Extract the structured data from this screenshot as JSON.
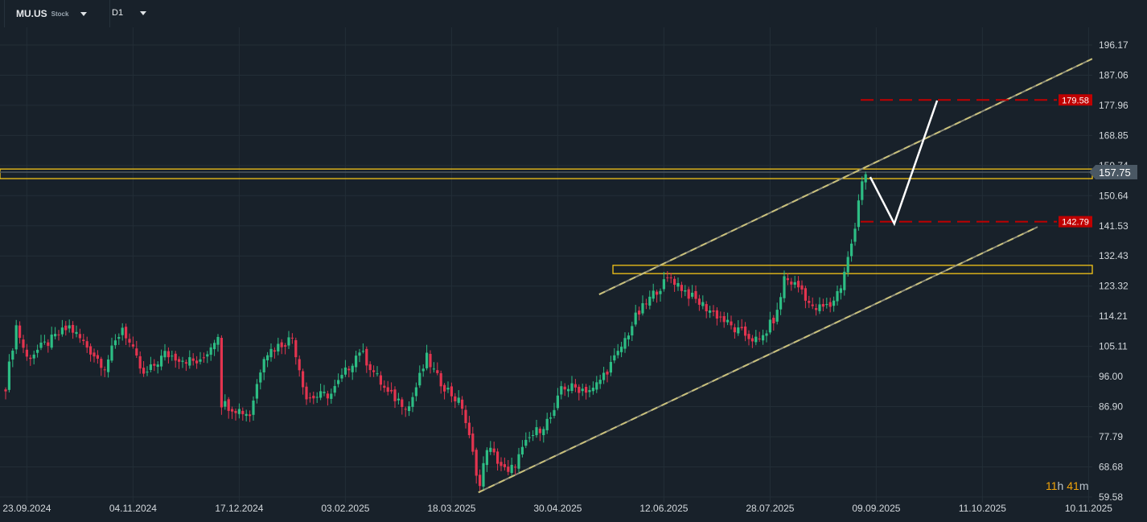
{
  "header": {
    "symbol": "MU.US",
    "type": "Stock",
    "timeframe": "D1"
  },
  "countdown": {
    "hours": "11",
    "h": "h",
    "minutes": "41",
    "m": "m"
  },
  "colors": {
    "bg": "#18212a",
    "grid": "#232e37",
    "up": "#2dbd84",
    "down": "#e3344f",
    "zone": "#f5c518",
    "channel": "#c9c07a",
    "target": "#c00000",
    "path": "#ffffff",
    "current": "#4a5560",
    "axisText": "#d3d8dc"
  },
  "chart_data": {
    "type": "candlestick",
    "title": "MU.US D1",
    "ylim": [
      59.58,
      196.17
    ],
    "y_ticks": [
      "196.17",
      "187.06",
      "177.96",
      "168.85",
      "159.74",
      "150.64",
      "141.53",
      "132.43",
      "123.32",
      "114.21",
      "105.11",
      "96.00",
      "86.90",
      "77.79",
      "68.68",
      "59.58"
    ],
    "x_ticks": [
      {
        "bar": 6,
        "label": "23.09.2024"
      },
      {
        "bar": 36,
        "label": "04.11.2024"
      },
      {
        "bar": 66,
        "label": "17.12.2024"
      },
      {
        "bar": 96,
        "label": "03.02.2025"
      },
      {
        "bar": 126,
        "label": "18.03.2025"
      },
      {
        "bar": 156,
        "label": "30.04.2025"
      },
      {
        "bar": 186,
        "label": "12.06.2025"
      },
      {
        "bar": 216,
        "label": "28.07.2025"
      },
      {
        "bar": 246,
        "label": "09.09.2025"
      },
      {
        "bar": 276,
        "label": "11.10.2025"
      },
      {
        "bar": 306,
        "label": "10.11.2025"
      }
    ],
    "close_path": [
      [
        0,
        93.1
      ],
      [
        3,
        111.3
      ],
      [
        6,
        101.6
      ],
      [
        18,
        111
      ],
      [
        28,
        99
      ],
      [
        33,
        111
      ],
      [
        39,
        96
      ],
      [
        45,
        102.8
      ],
      [
        55,
        100
      ],
      [
        60,
        109
      ],
      [
        61,
        88
      ],
      [
        69,
        84.6
      ],
      [
        73,
        102.8
      ],
      [
        81,
        107.7
      ],
      [
        85,
        89.5
      ],
      [
        92,
        90.7
      ],
      [
        100,
        104
      ],
      [
        108,
        90.7
      ],
      [
        114,
        87
      ],
      [
        119,
        101.6
      ],
      [
        122,
        95.5
      ],
      [
        129,
        87
      ],
      [
        132,
        72.4
      ],
      [
        134,
        62.7
      ],
      [
        136,
        74.9
      ],
      [
        142,
        66.3
      ],
      [
        148,
        77.3
      ],
      [
        155,
        84.6
      ],
      [
        157,
        93
      ],
      [
        166,
        91.9
      ],
      [
        173,
        102.8
      ],
      [
        178,
        113.8
      ],
      [
        184,
        122.3
      ],
      [
        188,
        125.9
      ],
      [
        194,
        119.8
      ],
      [
        202,
        113.8
      ],
      [
        206,
        110.1
      ],
      [
        213,
        106.5
      ],
      [
        218,
        115
      ],
      [
        220,
        125.9
      ],
      [
        225,
        122.3
      ],
      [
        228,
        116.2
      ],
      [
        233,
        117.4
      ],
      [
        236,
        123.5
      ],
      [
        238,
        132
      ],
      [
        240,
        140.5
      ],
      [
        241,
        149
      ],
      [
        242,
        155
      ],
      [
        243,
        157.5
      ]
    ],
    "current_price": "157.75",
    "levels": [
      {
        "price": 179.58,
        "label": "179.58"
      },
      {
        "price": 142.79,
        "label": "142.79"
      }
    ],
    "zones": [
      {
        "from_bar": -2,
        "top": 158.7,
        "bottom": 155.8
      },
      {
        "from_bar": 171.6,
        "top": 129.6,
        "bottom": 127.1
      }
    ],
    "channel": [
      {
        "bar1": 167.7,
        "p1": 120.8,
        "bar2": 307,
        "p2": 192
      },
      {
        "bar1": 133.6,
        "p1": 60.98,
        "bar2": 291.6,
        "p2": 141.2
      }
    ],
    "projection": [
      [
        244.3,
        156.3
      ],
      [
        251.1,
        142.2
      ],
      [
        263.2,
        179.4
      ]
    ]
  }
}
